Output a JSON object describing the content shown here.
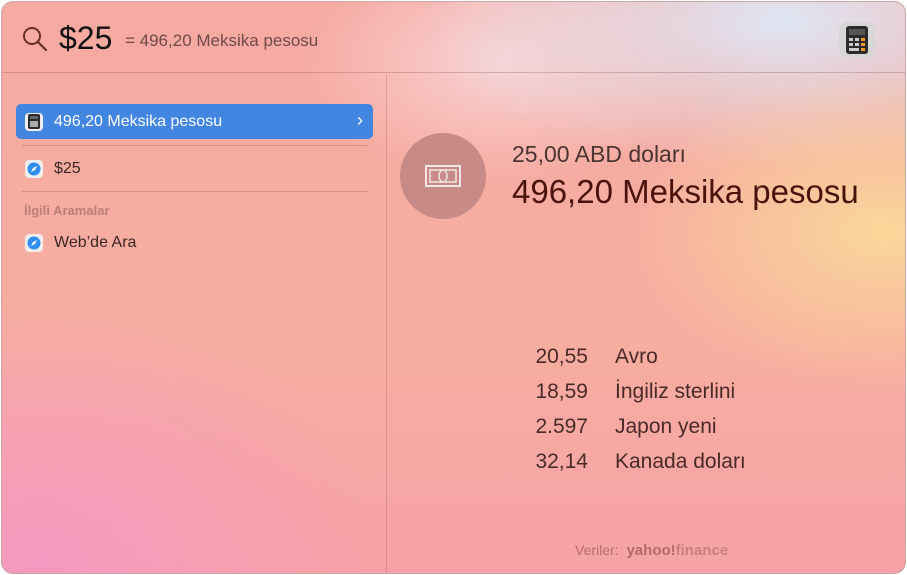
{
  "search": {
    "query": "$25",
    "hint": "= 496,20 Meksika pesosu",
    "icon": "search-icon",
    "app_icon": "calculator-icon"
  },
  "results": [
    {
      "label": "496,20 Meksika pesosu",
      "icon": "calculator-icon",
      "selected": true
    },
    {
      "label": "$25",
      "icon": "safari-icon"
    }
  ],
  "section_title": "İlgili Aramalar",
  "related": [
    {
      "label": "Web’de Ara",
      "icon": "safari-icon"
    }
  ],
  "detail": {
    "from": "25,00 ABD doları",
    "to": "496,20 Meksika pesosu",
    "rates": [
      {
        "value": "20,55",
        "currency": "Avro"
      },
      {
        "value": "18,59",
        "currency": "İngiliz sterlini"
      },
      {
        "value": "2.597",
        "currency": "Japon yeni"
      },
      {
        "value": "32,14",
        "currency": "Kanada doları"
      }
    ],
    "credit_label": "Veriler:",
    "credit_brand": "yahoo!",
    "credit_brand2": "finance"
  },
  "colors": {
    "accent": "#4286e2"
  }
}
